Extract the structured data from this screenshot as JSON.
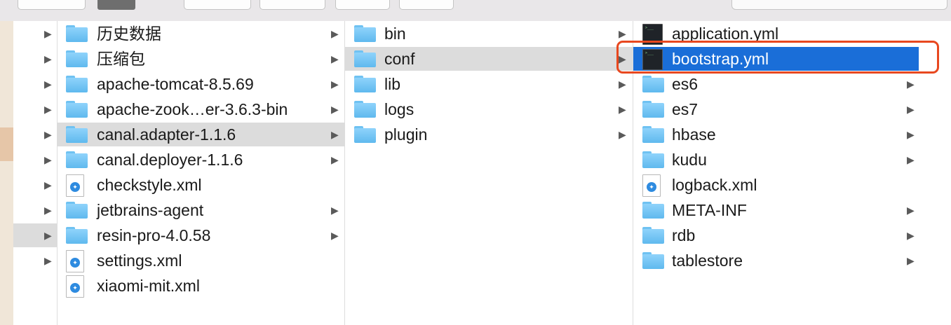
{
  "window": {
    "title": "Finder column view"
  },
  "colors": {
    "selection_blue": "#1a6ed8",
    "selection_gray": "#dcdcdc",
    "highlight_outline": "#e8481f",
    "folder_blue": "#6fc2f2"
  },
  "column0": {
    "rows": [
      {
        "arrow": "▶",
        "selected": false
      },
      {
        "arrow": "▶",
        "selected": false
      },
      {
        "arrow": "▶",
        "selected": false
      },
      {
        "arrow": "▶",
        "selected": false
      },
      {
        "arrow": "▶",
        "selected": false
      },
      {
        "arrow": "▶",
        "selected": false
      },
      {
        "arrow": "▶",
        "selected": false
      },
      {
        "arrow": "▶",
        "selected": false
      },
      {
        "arrow": "▶",
        "selected": true
      },
      {
        "arrow": "▶",
        "selected": false
      }
    ]
  },
  "column1": {
    "items": [
      {
        "name": "历史数据",
        "icon": "folder-icon",
        "has_children": true,
        "chevron": "▶"
      },
      {
        "name": "压缩包",
        "icon": "folder-icon",
        "has_children": true,
        "chevron": "▶"
      },
      {
        "name": "apache-tomcat-8.5.69",
        "icon": "folder-icon",
        "has_children": true,
        "chevron": "▶"
      },
      {
        "name": "apache-zook…er-3.6.3-bin",
        "icon": "folder-icon",
        "has_children": true,
        "chevron": "▶"
      },
      {
        "name": "canal.adapter-1.1.6",
        "icon": "folder-icon",
        "has_children": true,
        "chevron": "▶",
        "selected": true
      },
      {
        "name": "canal.deployer-1.1.6",
        "icon": "folder-icon",
        "has_children": true,
        "chevron": "▶"
      },
      {
        "name": "checkstyle.xml",
        "icon": "xml-file-icon",
        "has_children": false,
        "chevron": ""
      },
      {
        "name": "jetbrains-agent",
        "icon": "folder-icon",
        "has_children": true,
        "chevron": "▶"
      },
      {
        "name": "resin-pro-4.0.58",
        "icon": "folder-icon",
        "has_children": true,
        "chevron": "▶"
      },
      {
        "name": "settings.xml",
        "icon": "xml-file-icon",
        "has_children": false,
        "chevron": ""
      },
      {
        "name": "xiaomi-mit.xml",
        "icon": "xml-file-icon",
        "has_children": false,
        "chevron": ""
      }
    ]
  },
  "column2": {
    "items": [
      {
        "name": "bin",
        "icon": "folder-icon",
        "chevron": "▶"
      },
      {
        "name": "conf",
        "icon": "folder-icon",
        "chevron": "▶",
        "selected": true
      },
      {
        "name": "lib",
        "icon": "folder-icon",
        "chevron": "▶"
      },
      {
        "name": "logs",
        "icon": "folder-icon",
        "chevron": "▶"
      },
      {
        "name": "plugin",
        "icon": "folder-icon",
        "chevron": "▶"
      }
    ]
  },
  "column3": {
    "items": [
      {
        "name": "application.yml",
        "icon": "terminal-file-icon",
        "chevron": ""
      },
      {
        "name": "bootstrap.yml",
        "icon": "terminal-file-icon",
        "chevron": "",
        "selected": true
      },
      {
        "name": "es6",
        "icon": "folder-icon",
        "chevron": "▶"
      },
      {
        "name": "es7",
        "icon": "folder-icon",
        "chevron": "▶"
      },
      {
        "name": "hbase",
        "icon": "folder-icon",
        "chevron": "▶"
      },
      {
        "name": "kudu",
        "icon": "folder-icon",
        "chevron": "▶"
      },
      {
        "name": "logback.xml",
        "icon": "xml-file-icon",
        "chevron": ""
      },
      {
        "name": "META-INF",
        "icon": "folder-icon",
        "chevron": "▶"
      },
      {
        "name": "rdb",
        "icon": "folder-icon",
        "chevron": "▶"
      },
      {
        "name": "tablestore",
        "icon": "folder-icon",
        "chevron": "▶"
      }
    ]
  }
}
